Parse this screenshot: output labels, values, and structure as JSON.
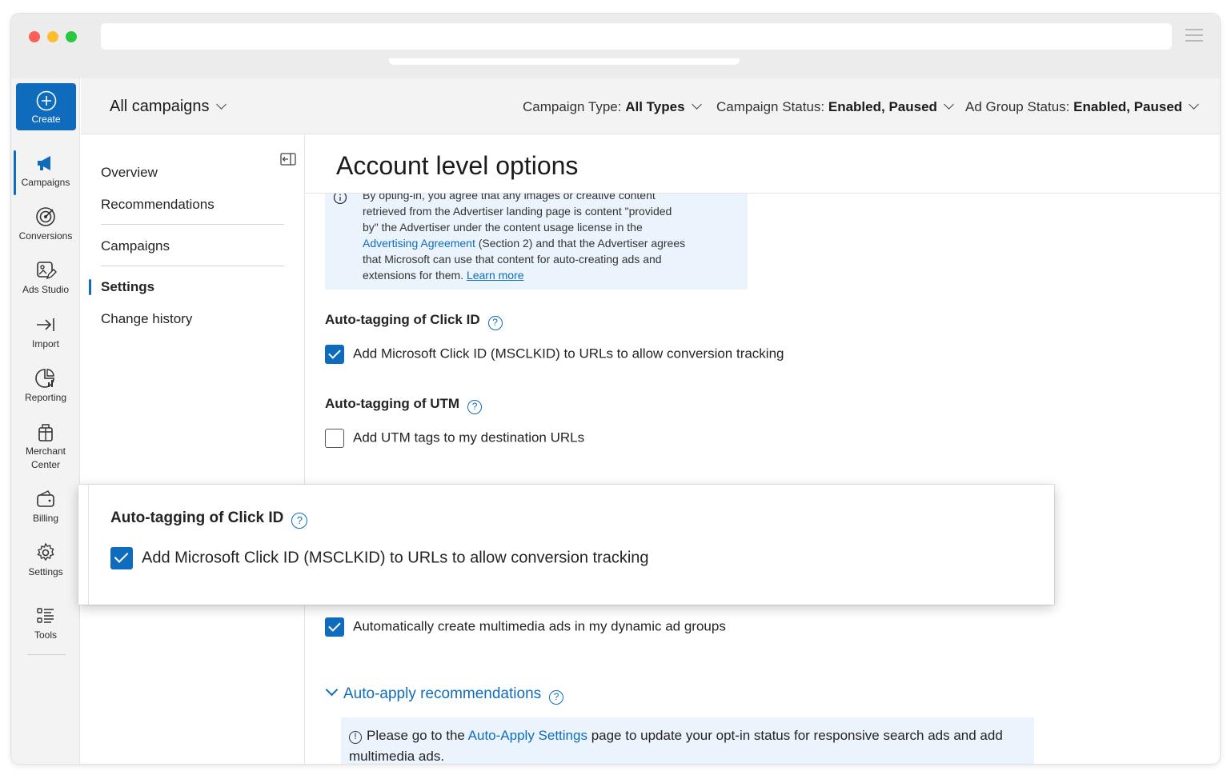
{
  "rail": {
    "create": "Create",
    "items": [
      {
        "label": "Campaigns",
        "icon": "megaphone-icon",
        "active": true
      },
      {
        "label": "Conversions",
        "icon": "target-icon"
      },
      {
        "label": "Ads Studio",
        "icon": "image-edit-icon"
      },
      {
        "label": "Import",
        "icon": "arrow-import-icon"
      },
      {
        "label": "Reporting",
        "icon": "report-chart-icon"
      },
      {
        "label": "Merchant Center",
        "icon": "gift-box-icon"
      },
      {
        "label": "Billing",
        "icon": "wallet-icon"
      },
      {
        "label": "Settings",
        "icon": "gear-icon"
      },
      {
        "label": "Tools",
        "icon": "tools-list-icon"
      }
    ]
  },
  "topbar": {
    "scope": "All campaigns",
    "filters": [
      {
        "label": "Campaign Type:",
        "value": "All Types"
      },
      {
        "label": "Campaign Status:",
        "value": "Enabled, Paused"
      },
      {
        "label": "Ad Group Status:",
        "value": "Enabled, Paused"
      }
    ]
  },
  "subnav": {
    "items": [
      "Overview",
      "Recommendations",
      "Campaigns",
      "Settings",
      "Change history"
    ],
    "active": "Settings"
  },
  "main": {
    "title": "Account level options",
    "info": {
      "line1": "By opting-in, you agree that any images or creative content",
      "line2": "retrieved from the Advertiser landing page is content \"provided",
      "line3": "by\" the Advertiser under the content usage license in the",
      "link": "Advertising Agreement",
      "line4_after": " (Section 2) and that the Advertiser agrees",
      "line5": "that Microsoft can use that content for auto-creating ads and",
      "line6": "extensions for them.",
      "learn_more": "Learn more"
    },
    "click_id": {
      "title": "Auto-tagging of Click ID",
      "checkbox_label": "Add Microsoft Click ID (MSCLKID) to URLs to allow conversion tracking",
      "checked": true
    },
    "utm": {
      "title": "Auto-tagging of UTM",
      "checkbox_label": "Add UTM tags to my destination URLs",
      "checked": false
    },
    "multimedia": {
      "checkbox_label": "Automatically create multimedia ads in my dynamic ad groups",
      "checked": true
    },
    "auto_apply": {
      "title": "Auto-apply recommendations",
      "note_before": "Please go to the ",
      "note_link": "Auto-Apply Settings",
      "note_after": " page to update your opt-in status for responsive search ads and add multimedia ads."
    }
  },
  "callout": {
    "title": "Auto-tagging of Click ID",
    "checkbox_label": "Add Microsoft Click ID (MSCLKID) to URLs to allow conversion tracking",
    "checked": true
  },
  "colors": {
    "accent": "#0f6cbd",
    "info_bg": "#ebf3fc",
    "rail_bg": "#f3f3f3"
  }
}
